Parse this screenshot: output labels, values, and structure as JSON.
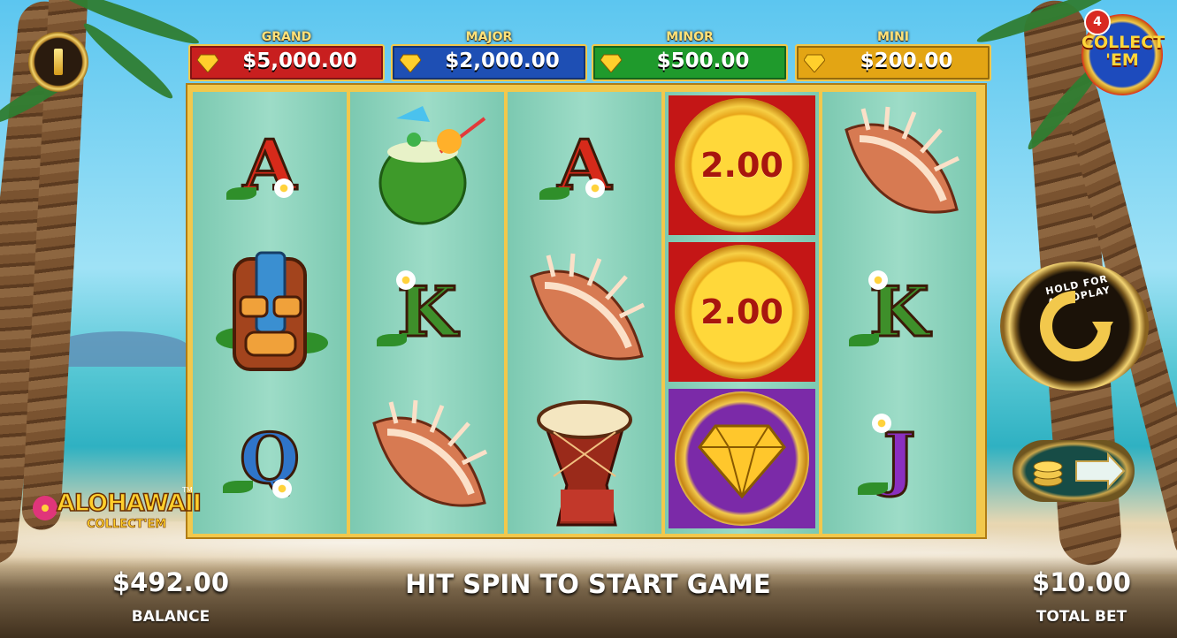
{
  "jackpots": [
    {
      "name": "GRAND",
      "value": "$5,000.00",
      "color": "#c81f1f"
    },
    {
      "name": "MAJOR",
      "value": "$2,000.00",
      "color": "#1e4fb4"
    },
    {
      "name": "MINOR",
      "value": "$500.00",
      "color": "#1f9a2c"
    },
    {
      "name": "MINI",
      "value": "$200.00",
      "color": "#e3a514"
    }
  ],
  "collect_badge": {
    "text_line1": "COLLECT",
    "text_line2": "'EM",
    "count": "4"
  },
  "reels": [
    [
      {
        "symbol": "letter-a"
      },
      {
        "symbol": "tiki-mask"
      },
      {
        "symbol": "letter-q"
      }
    ],
    [
      {
        "symbol": "coconut-drink"
      },
      {
        "symbol": "letter-k"
      },
      {
        "symbol": "conch-shell"
      }
    ],
    [
      {
        "symbol": "letter-a"
      },
      {
        "symbol": "conch-shell"
      },
      {
        "symbol": "drum"
      }
    ],
    [
      {
        "symbol": "coin",
        "value": "2.00"
      },
      {
        "symbol": "coin",
        "value": "2.00"
      },
      {
        "symbol": "diamond-coin"
      }
    ],
    [
      {
        "symbol": "conch-shell"
      },
      {
        "symbol": "letter-k"
      },
      {
        "symbol": "letter-j"
      }
    ]
  ],
  "letters": {
    "a": "A",
    "k": "K",
    "q": "Q",
    "j": "J"
  },
  "autoplay": {
    "label": "HOLD FOR AUTOPLAY"
  },
  "logo": {
    "main": "ALOHAWAII",
    "sub": "COLLECT'EM",
    "tm": "TM"
  },
  "footer": {
    "balance_value": "$492.00",
    "balance_label": "BALANCE",
    "status": "HIT SPIN TO START GAME",
    "bet_value": "$10.00",
    "bet_label": "TOTAL BET"
  },
  "colors": {
    "gold": "#f2c84c",
    "reel_bg": "#8fd5bf",
    "coin_text": "#a8160e"
  }
}
